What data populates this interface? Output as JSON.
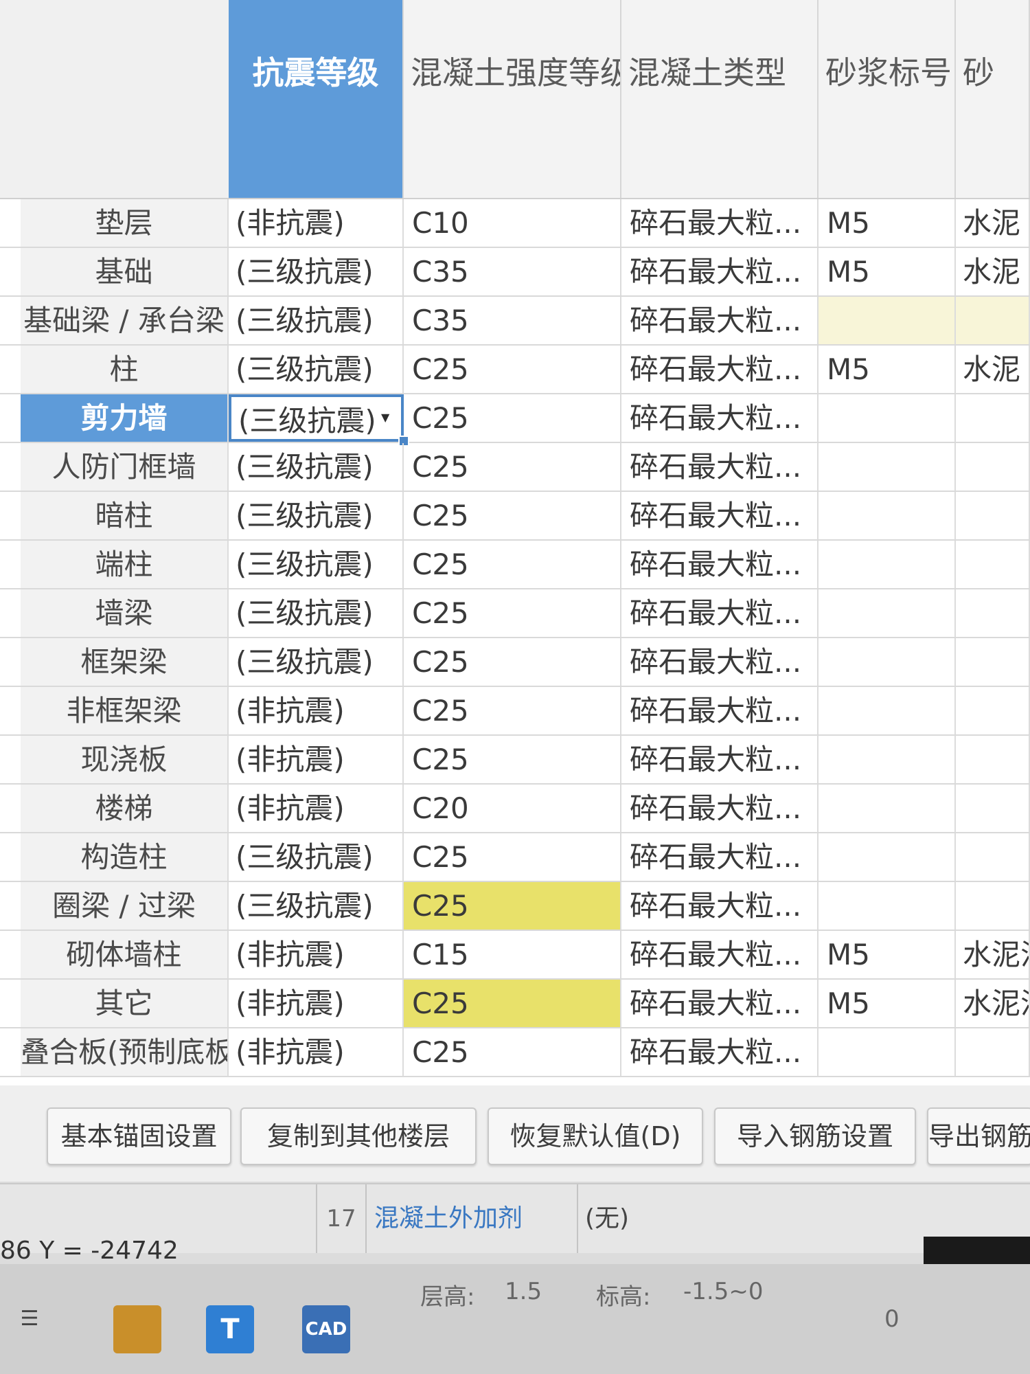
{
  "headers": {
    "seismic": "抗震等级",
    "concrete_grade": "混凝土强度等级",
    "concrete_type": "混凝土类型",
    "mortar_grade": "砂浆标号",
    "mortar_type": "砂"
  },
  "rows": [
    {
      "name": "垫层",
      "seismic": "(非抗震)",
      "concrete": "C10",
      "type": "碎石最大粒...",
      "mortar": "M5",
      "mortar_type": "水泥"
    },
    {
      "name": "基础",
      "seismic": "(三级抗震)",
      "concrete": "C35",
      "type": "碎石最大粒...",
      "mortar": "M5",
      "mortar_type": "水泥"
    },
    {
      "name": "基础梁 / 承台梁",
      "seismic": "(三级抗震)",
      "concrete": "C35",
      "type": "碎石最大粒...",
      "mortar": "",
      "mortar_type": ""
    },
    {
      "name": "柱",
      "seismic": "(三级抗震)",
      "concrete": "C25",
      "type": "碎石最大粒...",
      "mortar": "M5",
      "mortar_type": "水泥"
    },
    {
      "name": "剪力墙",
      "seismic": "(三级抗震)",
      "concrete": "C25",
      "type": "碎石最大粒...",
      "mortar": "",
      "mortar_type": ""
    },
    {
      "name": "人防门框墙",
      "seismic": "(三级抗震)",
      "concrete": "C25",
      "type": "碎石最大粒...",
      "mortar": "",
      "mortar_type": ""
    },
    {
      "name": "暗柱",
      "seismic": "(三级抗震)",
      "concrete": "C25",
      "type": "碎石最大粒...",
      "mortar": "",
      "mortar_type": ""
    },
    {
      "name": "端柱",
      "seismic": "(三级抗震)",
      "concrete": "C25",
      "type": "碎石最大粒...",
      "mortar": "",
      "mortar_type": ""
    },
    {
      "name": "墙梁",
      "seismic": "(三级抗震)",
      "concrete": "C25",
      "type": "碎石最大粒...",
      "mortar": "",
      "mortar_type": ""
    },
    {
      "name": "框架梁",
      "seismic": "(三级抗震)",
      "concrete": "C25",
      "type": "碎石最大粒...",
      "mortar": "",
      "mortar_type": ""
    },
    {
      "name": "非框架梁",
      "seismic": "(非抗震)",
      "concrete": "C25",
      "type": "碎石最大粒...",
      "mortar": "",
      "mortar_type": ""
    },
    {
      "name": "现浇板",
      "seismic": "(非抗震)",
      "concrete": "C25",
      "type": "碎石最大粒...",
      "mortar": "",
      "mortar_type": ""
    },
    {
      "name": "楼梯",
      "seismic": "(非抗震)",
      "concrete": "C20",
      "type": "碎石最大粒...",
      "mortar": "",
      "mortar_type": ""
    },
    {
      "name": "构造柱",
      "seismic": "(三级抗震)",
      "concrete": "C25",
      "type": "碎石最大粒...",
      "mortar": "",
      "mortar_type": ""
    },
    {
      "name": "圈梁 / 过梁",
      "seismic": "(三级抗震)",
      "concrete": "C25",
      "type": "碎石最大粒...",
      "mortar": "",
      "mortar_type": ""
    },
    {
      "name": "砌体墙柱",
      "seismic": "(非抗震)",
      "concrete": "C15",
      "type": "碎石最大粒...",
      "mortar": "M5",
      "mortar_type": "水泥混合..."
    },
    {
      "name": "其它",
      "seismic": "(非抗震)",
      "concrete": "C25",
      "type": "碎石最大粒...",
      "mortar": "M5",
      "mortar_type": "水泥混合..."
    },
    {
      "name": "叠合板(预制底板)",
      "seismic": "(非抗震)",
      "concrete": "C25",
      "type": "碎石最大粒...",
      "mortar": "",
      "mortar_type": ""
    }
  ],
  "buttons": {
    "anchor_settings": "基本锚固设置",
    "copy_floors": "复制到其他楼层",
    "restore_default": "恢复默认值(D)",
    "import_rebar": "导入钢筋设置",
    "export_rebar": "导出钢筋"
  },
  "property": {
    "index": "17",
    "name": "混凝土外加剂",
    "value": "(无)"
  },
  "status": {
    "coord": "86 Y = -24742",
    "floor_height_label": "层高:",
    "floor_height_value": "1.5",
    "elevation_label": "标高:",
    "elevation_value": "-1.5~0",
    "extra": "0"
  },
  "taskbar": {
    "t_app": "T",
    "cad_app": "CAD"
  },
  "colors": {
    "selection": "#5e9bd9",
    "highlight_yellow": "#e8e16a"
  }
}
